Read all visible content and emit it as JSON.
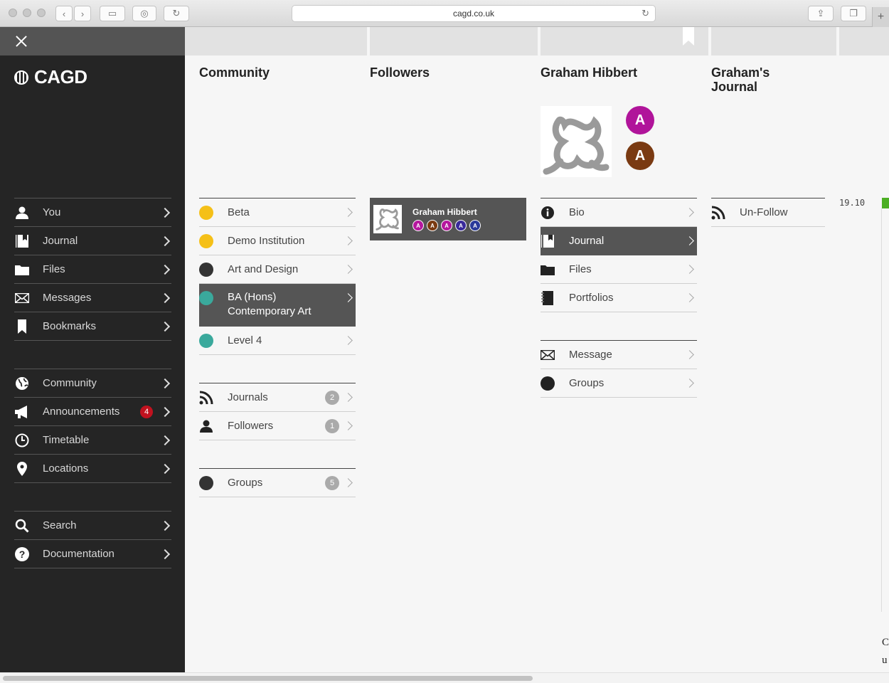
{
  "browser": {
    "url": "cagd.co.uk"
  },
  "sidebar": {
    "logo_text": "CAGD",
    "groups": [
      [
        {
          "label": "You",
          "icon": "user-icon"
        },
        {
          "label": "Journal",
          "icon": "journal-icon"
        },
        {
          "label": "Files",
          "icon": "folder-icon"
        },
        {
          "label": "Messages",
          "icon": "envelope-icon"
        },
        {
          "label": "Bookmarks",
          "icon": "bookmark-icon"
        }
      ],
      [
        {
          "label": "Community",
          "icon": "globe-icon"
        },
        {
          "label": "Announcements",
          "icon": "megaphone-icon",
          "badge": "4"
        },
        {
          "label": "Timetable",
          "icon": "clock-icon"
        },
        {
          "label": "Locations",
          "icon": "map-pin-icon"
        }
      ],
      [
        {
          "label": "Search",
          "icon": "search-icon"
        },
        {
          "label": "Documentation",
          "icon": "help-icon"
        }
      ]
    ]
  },
  "community": {
    "title": "Community",
    "institutions": [
      {
        "label": "Beta",
        "color": "#f5c018"
      },
      {
        "label": "Demo Institution",
        "color": "#f5c018"
      },
      {
        "label": "Art and Design",
        "color": "#333333"
      },
      {
        "label": "BA (Hons) Contemporary Art",
        "color": "#3aa99c",
        "active": true
      },
      {
        "label": "Level 4",
        "color": "#3aa99c"
      }
    ],
    "feeds": [
      {
        "label": "Journals",
        "count": "2",
        "icon": "rss-icon"
      },
      {
        "label": "Followers",
        "count": "1",
        "icon": "user-icon"
      }
    ],
    "groups": [
      {
        "label": "Groups",
        "count": "5"
      }
    ]
  },
  "followers": {
    "title": "Followers",
    "card": {
      "name": "Graham Hibbert",
      "dots": [
        {
          "letter": "A",
          "color": "#b5179e"
        },
        {
          "letter": "A",
          "color": "#7a3a12"
        },
        {
          "letter": "A",
          "color": "#b5179e"
        },
        {
          "letter": "A",
          "color": "#3a2a9a"
        },
        {
          "letter": "A",
          "color": "#2a3a9a"
        }
      ]
    }
  },
  "profile": {
    "title": "Graham Hibbert",
    "badges": [
      {
        "letter": "A",
        "color": "#b0149a"
      },
      {
        "letter": "A",
        "color": "#7a3a12"
      }
    ],
    "menu": [
      {
        "label": "Bio",
        "icon": "info-icon"
      },
      {
        "label": "Journal",
        "icon": "journal-icon",
        "active": true
      },
      {
        "label": "Files",
        "icon": "folder-icon"
      },
      {
        "label": "Portfolios",
        "icon": "notebook-icon"
      }
    ],
    "actions": [
      {
        "label": "Message",
        "icon": "envelope-icon"
      },
      {
        "label": "Groups",
        "icon": "circle-icon"
      }
    ]
  },
  "journal": {
    "title_line1": "Graham's",
    "title_line2": "Journal",
    "unfollow_label": "Un-Follow",
    "timestamp": "19.10",
    "edge_text": [
      "C",
      "u"
    ]
  }
}
